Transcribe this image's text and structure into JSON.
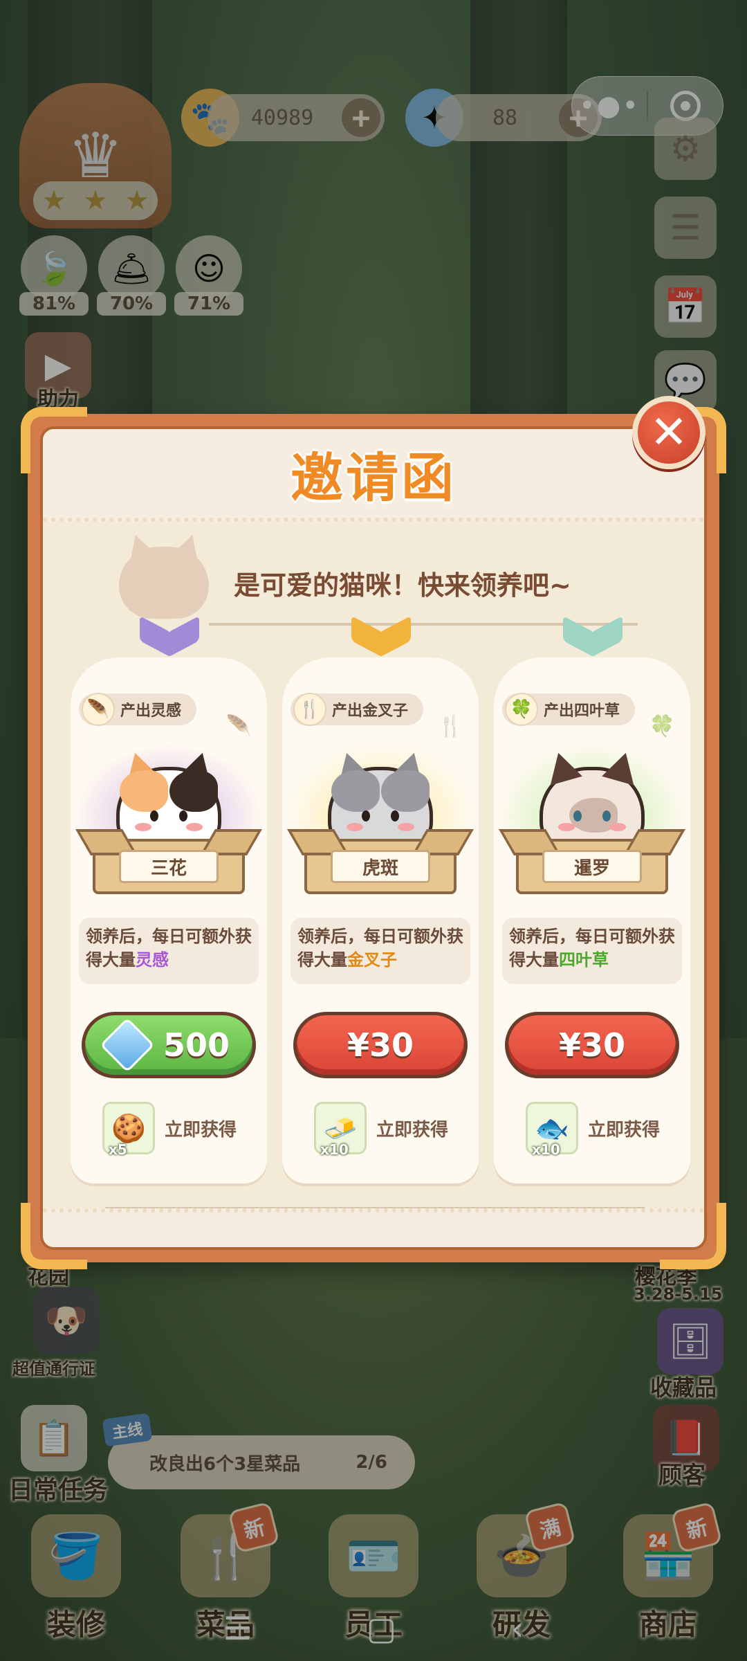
{
  "hud": {
    "coins": "40989",
    "gems": "88",
    "stats": [
      {
        "icon": "leaf-icon",
        "value": "81%"
      },
      {
        "icon": "cloche-icon",
        "value": "70%"
      },
      {
        "icon": "smile-icon",
        "value": "71%"
      }
    ],
    "left_menu": {
      "boost": "助力",
      "pass": "超值通行证",
      "daily": "日常任务",
      "garden": "花园"
    },
    "right_menu": {
      "collection": "收藏品",
      "customers": "顾客",
      "event": "樱花季",
      "event_dates": "3.28-5.15"
    }
  },
  "quest": {
    "tag": "主线",
    "text": "改良出6个3星菜品",
    "progress": "2/6"
  },
  "nav": [
    {
      "label": "装修",
      "icon": "paint-bucket-icon",
      "badge": ""
    },
    {
      "label": "菜品",
      "icon": "utensils-icon",
      "badge": "新"
    },
    {
      "label": "员工",
      "icon": "badge-icon",
      "badge": ""
    },
    {
      "label": "研发",
      "icon": "pot-icon",
      "badge": "满"
    },
    {
      "label": "商店",
      "icon": "shop-icon",
      "badge": "新"
    }
  ],
  "modal": {
    "title": "邀请函",
    "subtitle": "是可爱的猫咪！快来领养吧~",
    "cards": [
      {
        "produce": "产出灵感",
        "produce_icon": "feather-icon",
        "name": "三花",
        "desc_prefix": "领养后，每日可额外获得大量",
        "desc_highlight": "灵感",
        "highlight_color": "#a855d8",
        "price": "500",
        "price_type": "gem",
        "reward_qty": "x5",
        "reward_icon": "cookie-icon",
        "reward_label": "立即获得",
        "ribbon_color": "#a28ad6",
        "glow_color": "rgba(196,160,230,0.75)"
      },
      {
        "produce": "产出金叉子",
        "produce_icon": "fork-icon",
        "name": "虎斑",
        "desc_prefix": "领养后，每日可额外获得大量",
        "desc_highlight": "金叉子",
        "highlight_color": "#e08a14",
        "price": "¥30",
        "price_type": "cash",
        "reward_qty": "x10",
        "reward_icon": "tofu-icon",
        "reward_label": "立即获得",
        "ribbon_color": "#f2b33a",
        "glow_color": "rgba(250,230,140,0.8)"
      },
      {
        "produce": "产出四叶草",
        "produce_icon": "clover-icon",
        "name": "暹罗",
        "desc_prefix": "领养后，每日可额外获得大量",
        "desc_highlight": "四叶草",
        "highlight_color": "#4ea62e",
        "price": "¥30",
        "price_type": "cash",
        "reward_qty": "x10",
        "reward_icon": "fish-icon",
        "reward_label": "立即获得",
        "ribbon_color": "#9ed4c4",
        "glow_color": "rgba(180,235,150,0.8)"
      }
    ]
  }
}
